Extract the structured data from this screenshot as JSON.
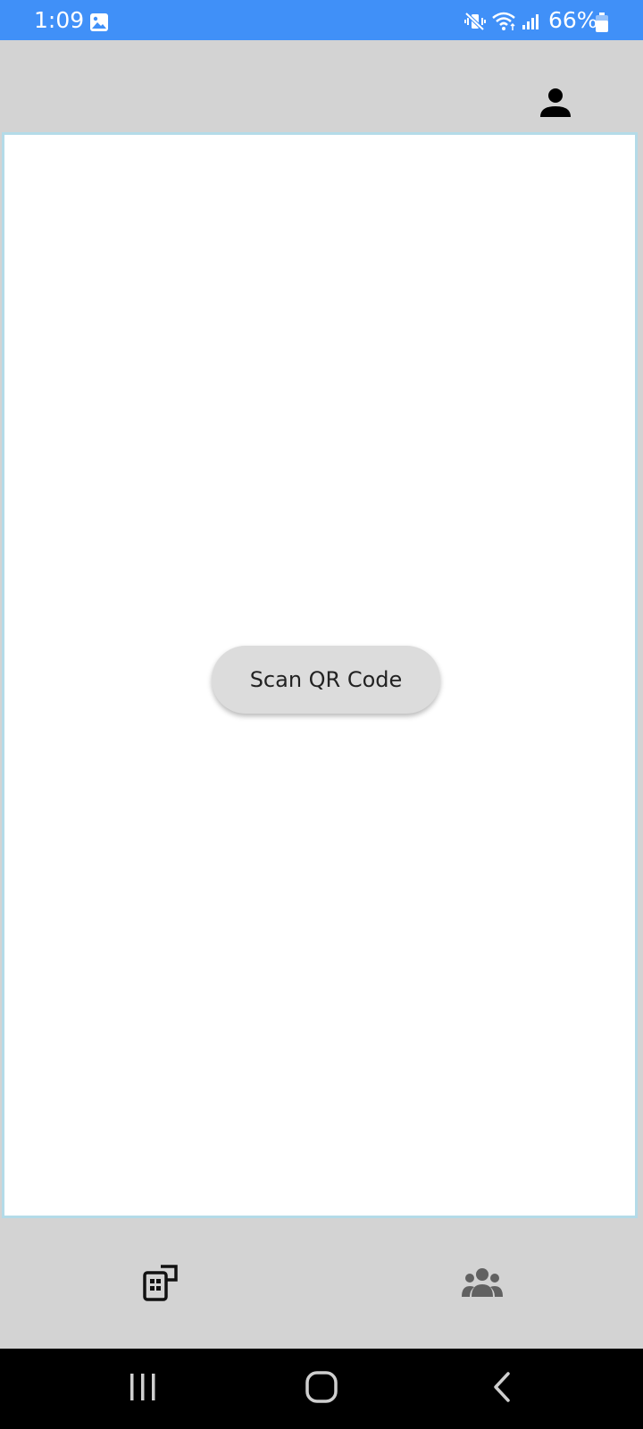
{
  "status_bar": {
    "time": "1:09",
    "battery_percent": "66%",
    "icons": [
      "image-icon",
      "mute-vibrate-icon",
      "wifi-icon",
      "signal-icon",
      "battery-icon"
    ]
  },
  "app_bar": {
    "profile_icon": "person-icon"
  },
  "main": {
    "scan_button_label": "Scan QR Code"
  },
  "bottom_nav": {
    "items": [
      {
        "icon": "qr-scanner-icon",
        "selected": true
      },
      {
        "icon": "group-icon",
        "selected": false
      }
    ]
  },
  "system_nav": {
    "buttons": [
      "recents-icon",
      "home-icon",
      "back-icon"
    ]
  },
  "colors": {
    "status_bar_bg": "#4090f8",
    "chrome_bg": "#d3d3d3",
    "content_border": "#b4dbe8",
    "button_bg": "#dcdcdc",
    "inactive_icon": "#616161",
    "active_icon": "#111111"
  }
}
